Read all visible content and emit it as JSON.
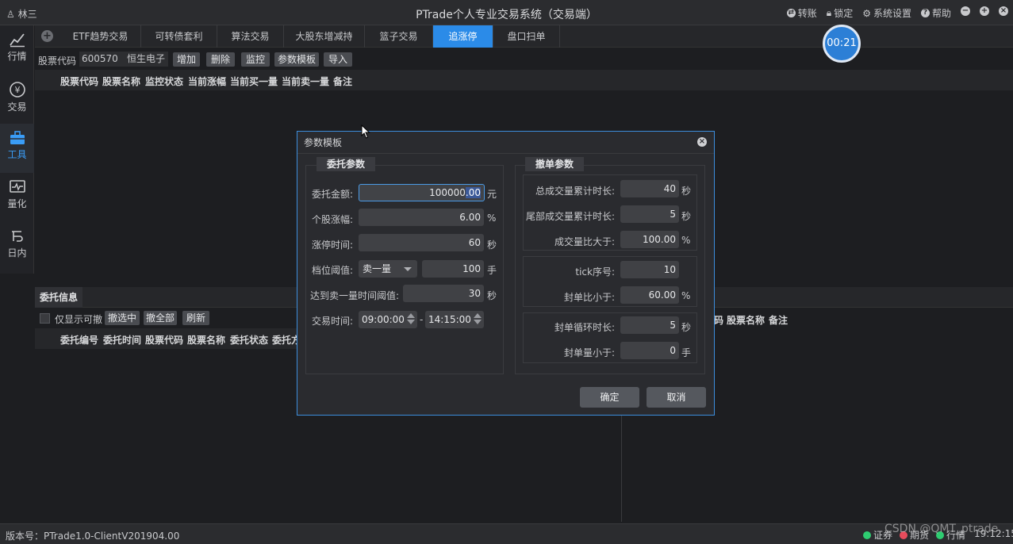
{
  "titlebar": {
    "user": "林三",
    "title": "PTrade个人专业交易系统（交易端）",
    "actions": [
      "转账",
      "锁定",
      "系统设置",
      "帮助"
    ]
  },
  "sidebar": [
    {
      "label": "行情",
      "icon": "chart-line-icon"
    },
    {
      "label": "交易",
      "icon": "yen-circle-icon"
    },
    {
      "label": "工具",
      "icon": "toolbox-icon",
      "active": true
    },
    {
      "label": "量化",
      "icon": "pulse-monitor-icon"
    },
    {
      "label": "日内",
      "icon": "intraday-icon"
    }
  ],
  "tabs": [
    "ETF趋势交易",
    "可转债套利",
    "算法交易",
    "大股东增减持",
    "篮子交易",
    "追涨停",
    "盘口扫单"
  ],
  "active_tab": "追涨停",
  "timer": "00:21",
  "stock": {
    "label": "股票代码",
    "code": "600570",
    "name": "恒生电子",
    "buttons": [
      "增加",
      "删除",
      "监控",
      "参数模板",
      "导入"
    ]
  },
  "upper_columns": [
    "股票代码",
    "股票名称",
    "监控状态",
    "当前涨幅",
    "当前买一量",
    "当前卖一量",
    "备注"
  ],
  "lower": {
    "tab": "委托信息",
    "checkbox_label": "仅显示可撤",
    "buttons": [
      "撤选中",
      "撤全部",
      "刷新"
    ],
    "columns": [
      "委托编号",
      "委托时间",
      "股票代码",
      "股票名称",
      "委托状态",
      "委托方"
    ],
    "right_columns": [
      "码",
      "股票名称",
      "备注"
    ]
  },
  "statusbar": {
    "version": "版本号：PTrade1.0-ClientV201904.00",
    "indicators": [
      {
        "label": "证券",
        "color": "#2ecc71"
      },
      {
        "label": "期货",
        "color": "#e74c5c"
      },
      {
        "label": "行情",
        "color": "#2ecc71"
      }
    ],
    "time": "19:12:15",
    "watermark": "CSDN @QMT_ptrade"
  },
  "dialog": {
    "title": "参数模板",
    "left_group": {
      "title": "委托参数",
      "fields": [
        {
          "label": "委托金额:",
          "value_main": "100000",
          "value_selected": ".00",
          "unit": "元"
        },
        {
          "label": "个股涨幅:",
          "value": "6.00",
          "unit": "%"
        },
        {
          "label": "涨停时间:",
          "value": "60",
          "unit": "秒"
        },
        {
          "label": "档位阈值:",
          "select": "卖一量",
          "value": "100",
          "unit": "手"
        },
        {
          "label": "达到卖一量时间阈值:",
          "value": "30",
          "unit": "秒"
        },
        {
          "label": "交易时间:",
          "start": "09:00:00",
          "sep": "-",
          "end": "14:15:00"
        }
      ]
    },
    "right_group": {
      "title": "撤单参数",
      "sections": [
        [
          {
            "label": "总成交量累计时长:",
            "value": "40",
            "unit": "秒"
          },
          {
            "label": "尾部成交量累计时长:",
            "value": "5",
            "unit": "秒"
          },
          {
            "label": "成交量比大于:",
            "value": "100.00",
            "unit": "%"
          }
        ],
        [
          {
            "label": "tick序号:",
            "value": "10",
            "unit": ""
          },
          {
            "label": "封单比小于:",
            "value": "60.00",
            "unit": "%"
          }
        ],
        [
          {
            "label": "封单循环时长:",
            "value": "5",
            "unit": "秒"
          },
          {
            "label": "封单量小于:",
            "value": "0",
            "unit": "手"
          }
        ]
      ]
    },
    "ok": "确定",
    "cancel": "取消"
  }
}
